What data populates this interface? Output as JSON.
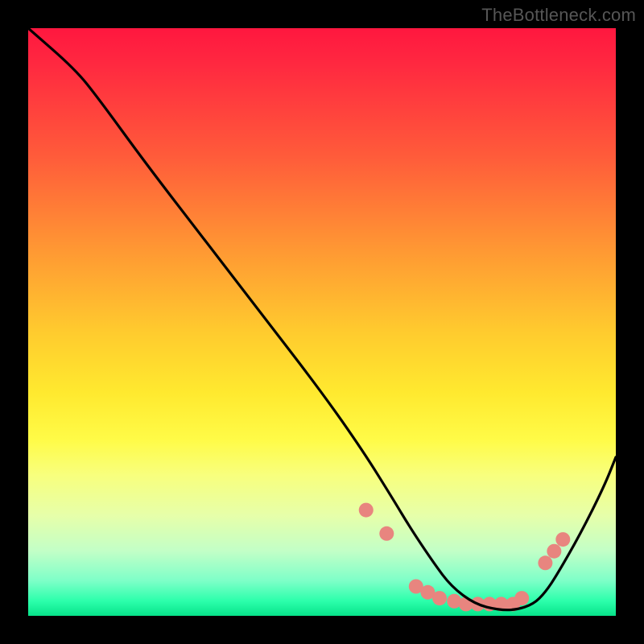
{
  "watermark": "TheBottleneck.com",
  "chart_data": {
    "type": "line",
    "title": "",
    "xlabel": "",
    "ylabel": "",
    "xlim": [
      0,
      100
    ],
    "ylim": [
      0,
      100
    ],
    "grid": false,
    "series": [
      {
        "name": "curve",
        "color": "#000000",
        "x": [
          0,
          8,
          12,
          20,
          30,
          40,
          50,
          57,
          62,
          65,
          69,
          72,
          76,
          80,
          83,
          86,
          88,
          90,
          94,
          98,
          100
        ],
        "y": [
          100,
          93,
          88,
          77,
          64,
          51,
          38,
          28,
          20,
          15,
          9,
          5,
          2,
          1,
          1,
          2,
          4,
          7,
          14,
          22,
          27
        ]
      }
    ],
    "markers": [
      {
        "name": "dots",
        "color": "#e8857f",
        "radius": 9,
        "x": [
          57.5,
          61.0,
          66.0,
          68.0,
          70.0,
          72.5,
          74.5,
          76.5,
          78.5,
          80.5,
          82.5,
          84.0,
          88.0,
          89.5,
          91.0
        ],
        "y": [
          18.0,
          14.0,
          5.0,
          4.0,
          3.0,
          2.5,
          2.0,
          2.0,
          2.0,
          2.0,
          2.0,
          3.0,
          9.0,
          11.0,
          13.0
        ]
      }
    ]
  }
}
